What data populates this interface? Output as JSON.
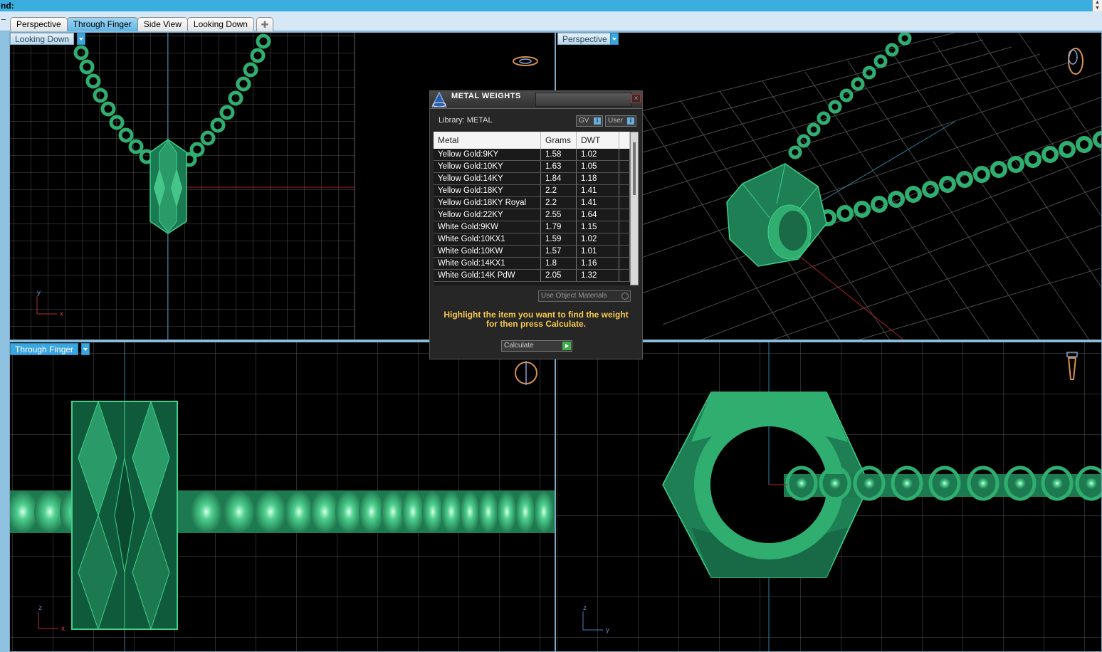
{
  "command_bar": {
    "text": "nd:"
  },
  "tabs": [
    {
      "label": "Perspective",
      "active": false
    },
    {
      "label": "Through Finger",
      "active": true
    },
    {
      "label": "Side View",
      "active": false
    },
    {
      "label": "Looking Down",
      "active": false
    }
  ],
  "add_tab_icon": "plus-icon",
  "viewports": {
    "top_left": {
      "label": "Looking Down",
      "axis_h": "x",
      "axis_v": "y"
    },
    "top_right": {
      "label": "Perspective"
    },
    "bottom_left": {
      "label": "Through Finger",
      "axis_h": "x",
      "axis_v": "z"
    },
    "bottom_right": {
      "axis_h": "y",
      "axis_v": "z"
    }
  },
  "dialog": {
    "title": "METAL WEIGHTS",
    "library_label": "Library: METAL",
    "gv_label": "GV",
    "user_label": "User",
    "columns": [
      "Metal",
      "Grams",
      "DWT"
    ],
    "rows": [
      [
        "Yellow Gold:9KY",
        "1.58",
        "1.02"
      ],
      [
        "Yellow Gold:10KY",
        "1.63",
        "1.05"
      ],
      [
        "Yellow Gold:14KY",
        "1.84",
        "1.18"
      ],
      [
        "Yellow Gold:18KY",
        "2.2",
        "1.41"
      ],
      [
        "Yellow Gold:18KY Royal",
        "2.2",
        "1.41"
      ],
      [
        "Yellow Gold:22KY",
        "2.55",
        "1.64"
      ],
      [
        "White Gold:9KW",
        "1.79",
        "1.15"
      ],
      [
        "White Gold:10KX1",
        "1.59",
        "1.02"
      ],
      [
        "White Gold:10KW",
        "1.57",
        "1.01"
      ],
      [
        "White Gold:14KX1",
        "1.8",
        "1.16"
      ],
      [
        "White Gold:14K PdW",
        "2.05",
        "1.32"
      ]
    ],
    "use_object_materials": "Use Object Materials",
    "hint_line1": "Highlight the item you want to find the weight",
    "hint_line2": "for then press Calculate.",
    "calculate_label": "Calculate"
  },
  "colors": {
    "model_green": "#2fa06a",
    "grid": "#5a5a5a",
    "active_blue": "#3aa6df",
    "hint_yellow": "#f6c84d"
  }
}
